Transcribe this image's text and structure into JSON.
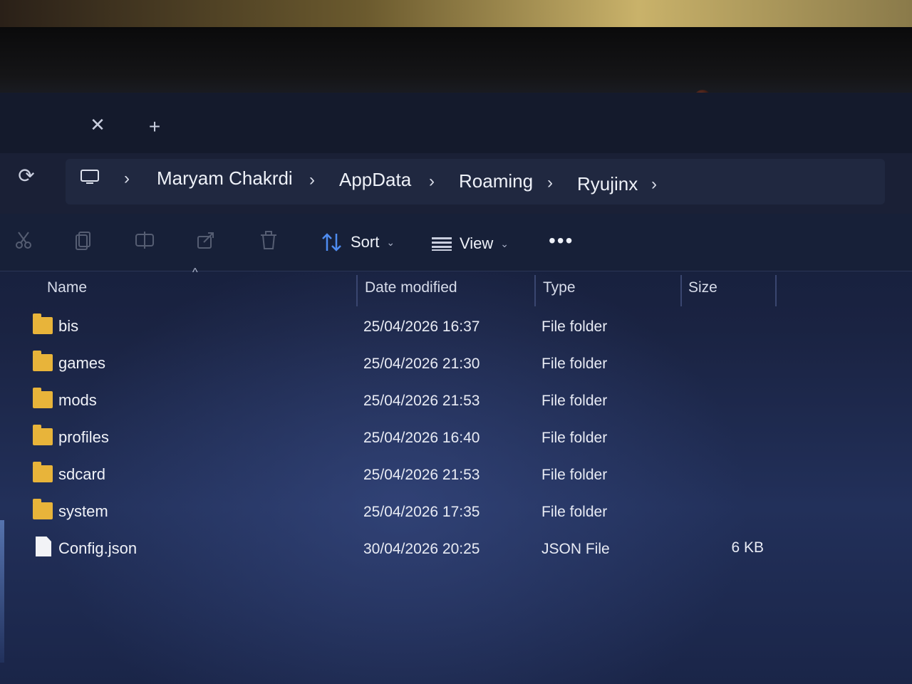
{
  "tabs": {
    "close_symbol": "✕",
    "add_symbol": "+"
  },
  "nav": {
    "refresh_symbol": "⟳"
  },
  "breadcrumb": {
    "separator": "›",
    "items": [
      "Maryam Chakrdi",
      "AppData",
      "Roaming",
      "Ryujinx"
    ]
  },
  "toolbar": {
    "sort_label": "Sort",
    "view_label": "View",
    "more_label": "•••"
  },
  "columns": {
    "name": "Name",
    "date": "Date modified",
    "type": "Type",
    "size": "Size",
    "sort_indicator": "^"
  },
  "files": [
    {
      "name": "bis",
      "date": "25/04/2026 16:37",
      "type": "File folder",
      "size": "",
      "icon": "folder-icon"
    },
    {
      "name": "games",
      "date": "25/04/2026 21:30",
      "type": "File folder",
      "size": "",
      "icon": "folder-icon"
    },
    {
      "name": "mods",
      "date": "25/04/2026 21:53",
      "type": "File folder",
      "size": "",
      "icon": "folder-icon"
    },
    {
      "name": "profiles",
      "date": "25/04/2026 16:40",
      "type": "File folder",
      "size": "",
      "icon": "folder-icon"
    },
    {
      "name": "sdcard",
      "date": "25/04/2026 21:53",
      "type": "File folder",
      "size": "",
      "icon": "folder-icon"
    },
    {
      "name": "system",
      "date": "25/04/2026 17:35",
      "type": "File folder",
      "size": "",
      "icon": "folder-icon"
    },
    {
      "name": "Config.json",
      "date": "30/04/2026 20:25",
      "type": "JSON File",
      "size": "6 KB",
      "icon": "file-icon"
    }
  ],
  "colors": {
    "folder": "#e8b43a",
    "accent": "#4f8cf0",
    "background": "#1a2342"
  }
}
